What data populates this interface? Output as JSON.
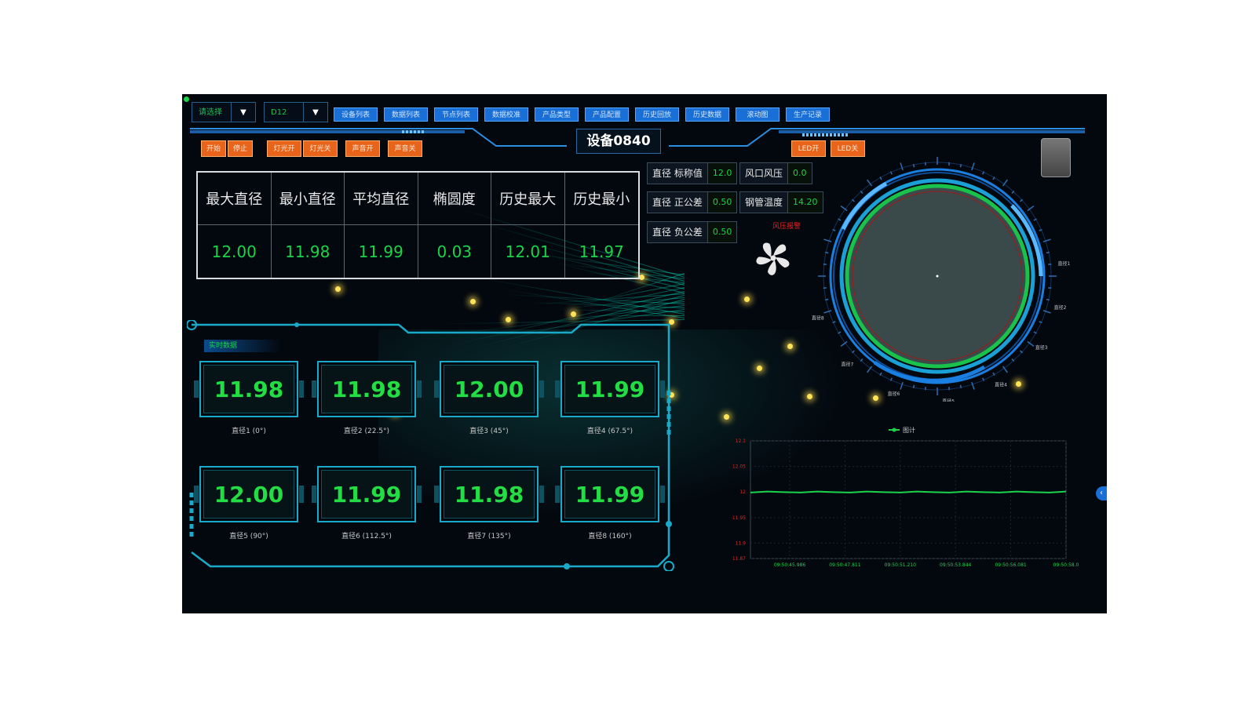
{
  "toolbar": {
    "port_select": "请选择",
    "device_select": "D12",
    "nav": [
      "设备列表",
      "数据列表",
      "节点列表",
      "数据校准",
      "产品类型",
      "产品配置",
      "历史回放",
      "历史数据",
      "滚动图",
      "生产记录"
    ]
  },
  "title": "设备0840",
  "left_buttons": [
    "开始",
    "停止",
    "灯光开",
    "灯光关",
    "声音开",
    "声音关"
  ],
  "right_buttons": [
    "LED开",
    "LED关"
  ],
  "stats": {
    "headers": [
      "最大直径",
      "最小直径",
      "平均直径",
      "椭圆度",
      "历史最大",
      "历史最小"
    ],
    "values": [
      "12.00",
      "11.98",
      "11.99",
      "0.03",
      "12.01",
      "11.97"
    ]
  },
  "params": [
    {
      "label": "直径 标称值",
      "value": "12.0"
    },
    {
      "label": "风口风压",
      "value": "0.0"
    },
    {
      "label": "直径 正公差",
      "value": "0.50"
    },
    {
      "label": "钢管温度",
      "value": "14.20"
    },
    {
      "label": "直径 负公差",
      "value": "0.50"
    }
  ],
  "alarm_label": "风压报警",
  "realtime": {
    "title": "实时数据",
    "cards": [
      {
        "value": "11.98",
        "label": "直径1 (0°)"
      },
      {
        "value": "11.98",
        "label": "直径2 (22.5°)"
      },
      {
        "value": "12.00",
        "label": "直径3 (45°)"
      },
      {
        "value": "11.99",
        "label": "直径4 (67.5°)"
      },
      {
        "value": "12.00",
        "label": "直径5 (90°)"
      },
      {
        "value": "11.99",
        "label": "直径6 (112.5°)"
      },
      {
        "value": "11.98",
        "label": "直径7 (135°)"
      },
      {
        "value": "11.99",
        "label": "直径8 (160°)"
      }
    ]
  },
  "gauge": {
    "labels": [
      "直径1",
      "直径2",
      "直径3",
      "直径4",
      "直径5",
      "直径6",
      "直径7",
      "直径8"
    ]
  },
  "chart_data": {
    "type": "line",
    "series": [
      {
        "name": "图计",
        "color": "#19d34a",
        "values": [
          12.0,
          12.0,
          12.0,
          12.0,
          12.0,
          12.0,
          12.0,
          12.0,
          12.0,
          12.0,
          12.0,
          12.0,
          12.0,
          12.0,
          12.0,
          12.0,
          12.0,
          12.0,
          12.0,
          12.0
        ]
      }
    ],
    "x": [
      "09:50:45.986",
      "09:50:47.811",
      "09:50:51.210",
      "09:50:53.844",
      "09:50:56.081",
      "09:50:58.0"
    ],
    "y_ticks": [
      "12.1",
      "12.05",
      "12",
      "11.95",
      "11.9",
      "11.87"
    ],
    "ylim": [
      11.87,
      12.1
    ],
    "grid": true,
    "legend": "top-center"
  },
  "colors": {
    "accent": "#19d34a",
    "frame": "#19a9c9",
    "nav": "#1a6fd6",
    "orange": "#e8641b"
  }
}
